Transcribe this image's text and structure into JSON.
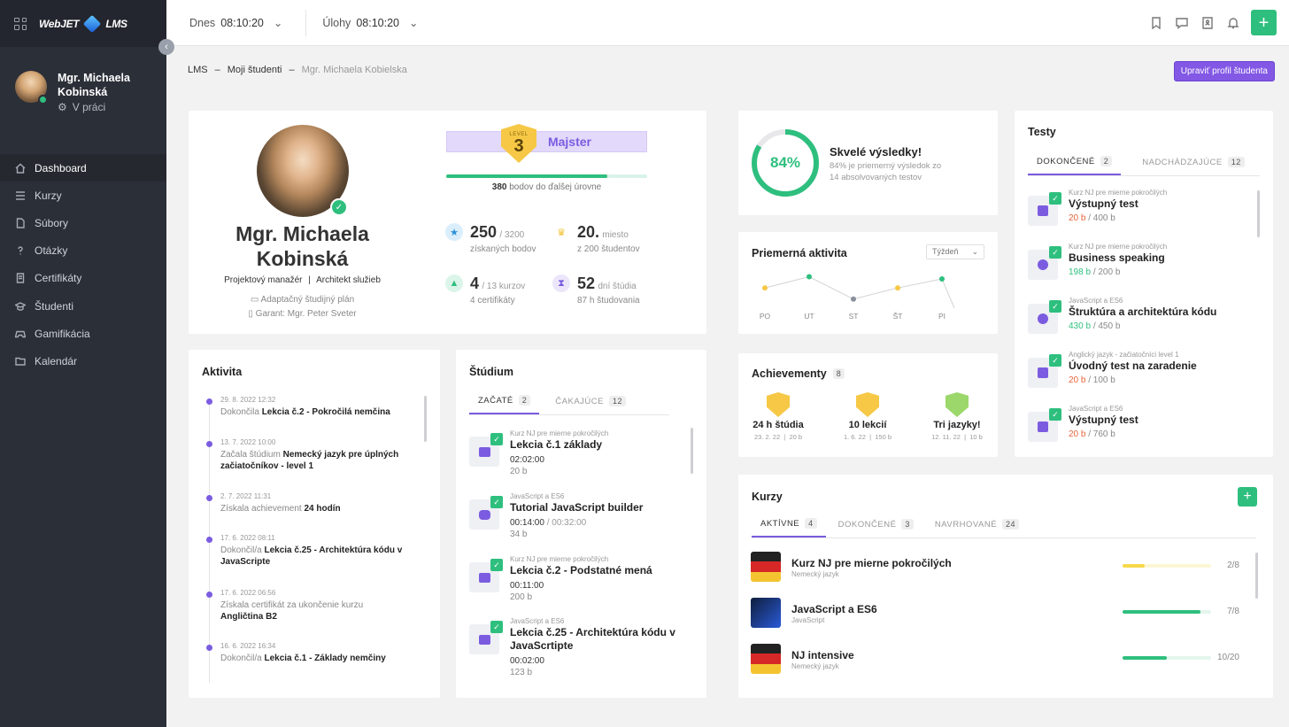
{
  "app": {
    "logo_text_left": "WebJET",
    "logo_text_right": "LMS"
  },
  "sidebar": {
    "user_name": "Mgr. Michaela Kobinská",
    "user_status": "V práci",
    "items": [
      {
        "label": "Dashboard",
        "icon": "home-icon",
        "active": true
      },
      {
        "label": "Kurzy",
        "icon": "list-icon"
      },
      {
        "label": "Súbory",
        "icon": "file-icon"
      },
      {
        "label": "Otázky",
        "icon": "question-icon"
      },
      {
        "label": "Certifikáty",
        "icon": "certificate-icon"
      },
      {
        "label": "Študenti",
        "icon": "graduation-cap-icon"
      },
      {
        "label": "Gamifikácia",
        "icon": "gamepad-icon"
      },
      {
        "label": "Kalendár",
        "icon": "folder-icon"
      }
    ]
  },
  "topbar": {
    "today_label": "Dnes",
    "today_time": "08:10:20",
    "tasks_label": "Úlohy",
    "tasks_time": "08:10:20"
  },
  "breadcrumb": {
    "root": "LMS",
    "section": "Moji študenti",
    "current": "Mgr. Michaela Kobielska",
    "sep": "–"
  },
  "edit_button": "Upraviť profil študenta",
  "profile": {
    "name_line1": "Mgr. Michaela",
    "name_line2": "Kobinská",
    "role1": "Projektový manažér",
    "role_sep": "|",
    "role2": "Architekt služieb",
    "plan": "Adaptačný študijný plán",
    "guarantor": "Garant: Mgr. Peter Sveter",
    "level_word": "LEVEL",
    "level": "3",
    "rank": "Majster",
    "level_progress_pct": 80,
    "points_to_next": "380",
    "points_to_next_text": "bodov do ďalšej úrovne",
    "stats": {
      "points": "250",
      "points_total": "/ 3200",
      "points_sub": "získaných bodov",
      "place": "20.",
      "place_word": "miesto",
      "place_sub": "z 200 študentov",
      "courses": "4",
      "courses_total": "/ 13 kurzov",
      "courses_sub": "4 certifikáty",
      "days": "52",
      "days_word": "dní štúdia",
      "days_sub": "87 h študovania"
    }
  },
  "results": {
    "percent": "84%",
    "percent_value": 84,
    "title": "Skvelé výsledky!",
    "line1": "84% je priemerný výsledok zo",
    "line2": "14 absolvovaných testov"
  },
  "activity_chart": {
    "title": "Priemerná aktivita",
    "period": "Týždeň",
    "chart_data": {
      "type": "line",
      "categories": [
        "PO",
        "UT",
        "ST",
        "ŠT",
        "PI"
      ],
      "values": [
        2,
        3,
        1,
        2,
        2.8
      ],
      "colors": [
        "#f6c846",
        "#2ebf7e",
        "#8a8f9c",
        "#f6c846",
        "#2ebf7e"
      ]
    }
  },
  "achievements": {
    "title": "Achievementy",
    "count": "8",
    "items": [
      {
        "title": "24 h štúdia",
        "date": "23. 2. 22",
        "pts": "20 b"
      },
      {
        "title": "10 lekcií",
        "date": "1. 6. 22",
        "pts": "150 b"
      },
      {
        "title": "Tri jazyky!",
        "date": "12. 11. 22",
        "pts": "10 b"
      }
    ]
  },
  "tests": {
    "title": "Testy",
    "tab_done": "DOKONČENÉ",
    "tab_done_count": "2",
    "tab_upcoming": "NADCHÁDZAJÚCE",
    "tab_upcoming_count": "12",
    "items": [
      {
        "cat": "Kurz NJ pre mierne pokročilých",
        "title": "Výstupný test",
        "score": "20 b",
        "total": "/ 400 b",
        "good": false
      },
      {
        "cat": "Kurz NJ pre mierne pokročilých",
        "title": "Business speaking",
        "score": "198 b",
        "total": "/ 200 b",
        "good": true
      },
      {
        "cat": "JavaScript a ES6",
        "title": "Štruktúra a architektúra kódu",
        "score": "430 b",
        "total": "/ 450 b",
        "good": true
      },
      {
        "cat": "Anglický jazyk - začiatočníci level 1",
        "title": "Úvodný test na zaradenie",
        "score": "20 b",
        "total": "/ 100 b",
        "good": false
      },
      {
        "cat": "JavaScript a ES6",
        "title": "Výstupný test",
        "score": "20 b",
        "total": "/ 760 b",
        "good": false
      }
    ]
  },
  "activity": {
    "title": "Aktivita",
    "items": [
      {
        "date": "29. 8. 2022 12:32",
        "pre": "Dokončila",
        "bold": "Lekcia č.2 - Pokročilá nemčina"
      },
      {
        "date": "13. 7. 2022 10:00",
        "pre": "Začala štúdium",
        "bold": "Nemecký jazyk pre úplných začiatočníkov - level 1"
      },
      {
        "date": "2. 7. 2022 11:31",
        "pre": "Získala achievement",
        "bold": "24 hodín"
      },
      {
        "date": "17. 6. 2022 08:11",
        "pre": "Dokončil/a",
        "bold": "Lekcia č.25 - Architektúra kódu v JavaScripte"
      },
      {
        "date": "17. 6. 2022 06:56",
        "pre": "Získala certifikát za ukončenie kurzu",
        "bold": "Angličtina B2"
      },
      {
        "date": "16. 6. 2022 16:34",
        "pre": "Dokončil/a",
        "bold": "Lekcia č.1 - Základy nemčiny"
      }
    ]
  },
  "study": {
    "title": "Štúdium",
    "tab_started": "ZAČATÉ",
    "tab_started_count": "2",
    "tab_waiting": "ČAKAJÚCE",
    "tab_waiting_count": "12",
    "items": [
      {
        "cat": "Kurz NJ pre mierne pokročilých",
        "title": "Lekcia č.1 základy",
        "time": "02:02:00",
        "time_total": "",
        "pts": "20 b",
        "icon": "article-icon"
      },
      {
        "cat": "JavaScript a ES6",
        "title": "Tutorial JavaScript builder",
        "time": "00:14:00",
        "time_total": "/ 00:32:00",
        "pts": "34 b",
        "icon": "video-icon"
      },
      {
        "cat": "Kurz NJ pre mierne pokročilých",
        "title": "Lekcia č.2 - Podstatné mená",
        "time": "00:11:00",
        "time_total": "",
        "pts": "200 b",
        "icon": "article-icon"
      },
      {
        "cat": "JavaScript a ES6",
        "title": "Lekcia č.25 - Architektúra kódu v JavaScrtipte",
        "time": "00:02:00",
        "time_total": "",
        "pts": "123 b",
        "icon": "article-icon"
      }
    ]
  },
  "courses": {
    "title": "Kurzy",
    "tab_active": "AKTÍVNE",
    "tab_active_count": "4",
    "tab_done": "DOKONČENÉ",
    "tab_done_count": "3",
    "tab_suggested": "NAVRHOVANÉ",
    "tab_suggested_count": "24",
    "items": [
      {
        "name": "Kurz NJ pre mierne pokročilých",
        "sub": "Nemecký jazyk",
        "done": 2,
        "total": 8,
        "frac": "2/8",
        "color": "#f6d94a",
        "flag": "de"
      },
      {
        "name": "JavaScript a ES6",
        "sub": "JavaScript",
        "done": 7,
        "total": 8,
        "frac": "7/8",
        "color": "#2ebf7e",
        "flag": "js"
      },
      {
        "name": "NJ intensive",
        "sub": "Nemecký jazyk",
        "done": 10,
        "total": 20,
        "frac": "10/20",
        "color": "#2ebf7e",
        "flag": "de"
      }
    ]
  }
}
